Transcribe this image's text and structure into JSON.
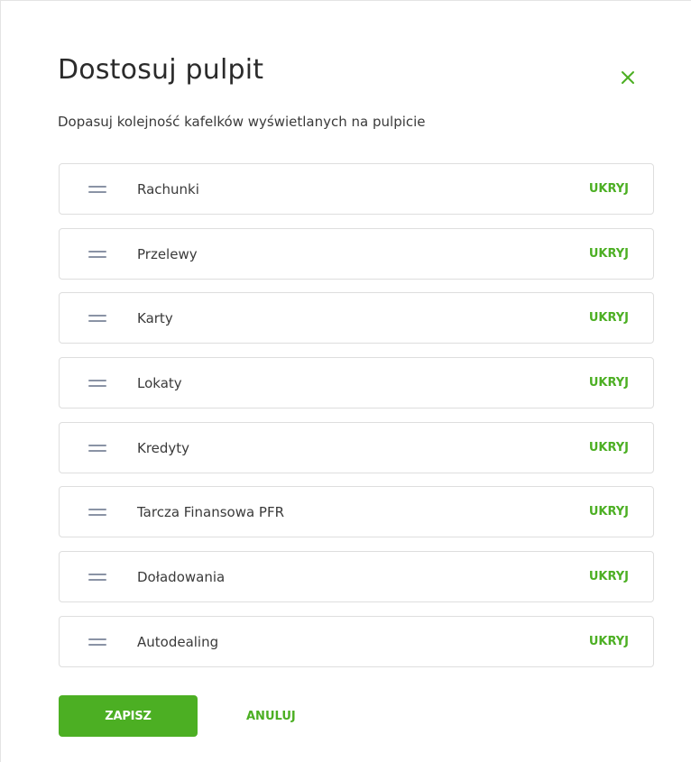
{
  "dialog": {
    "title": "Dostosuj pulpit",
    "subtitle": "Dopasuj kolejność kafelków wyświetlanych na pulpicie",
    "close_icon": "close-icon"
  },
  "tiles": [
    {
      "label": "Rachunki",
      "action": "UKRYJ",
      "icon": "drag-handle-icon"
    },
    {
      "label": "Przelewy",
      "action": "UKRYJ",
      "icon": "drag-handle-icon"
    },
    {
      "label": "Karty",
      "action": "UKRYJ",
      "icon": "drag-handle-icon"
    },
    {
      "label": "Lokaty",
      "action": "UKRYJ",
      "icon": "drag-handle-icon"
    },
    {
      "label": "Kredyty",
      "action": "UKRYJ",
      "icon": "drag-handle-icon"
    },
    {
      "label": "Tarcza Finansowa PFR",
      "action": "UKRYJ",
      "icon": "drag-handle-icon"
    },
    {
      "label": "Doładowania",
      "action": "UKRYJ",
      "icon": "drag-handle-icon"
    },
    {
      "label": "Autodealing",
      "action": "UKRYJ",
      "icon": "drag-handle-icon"
    }
  ],
  "footer": {
    "save_label": "ZAPISZ",
    "cancel_label": "ANULUJ"
  },
  "colors": {
    "accent": "#4caf23",
    "drag_handle": "#8a93a5",
    "text": "#3a3a3a",
    "border": "#dedede"
  }
}
